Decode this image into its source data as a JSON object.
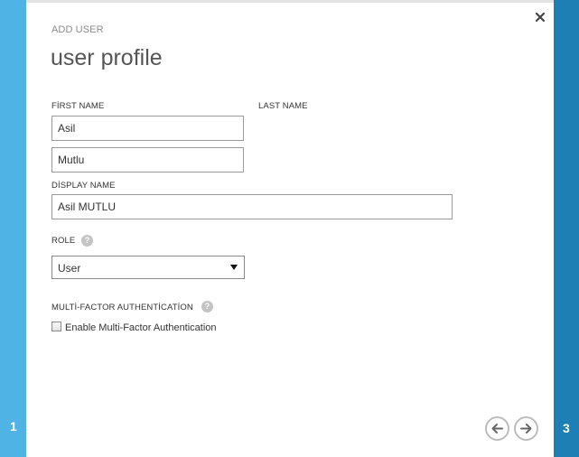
{
  "wizard": {
    "header": "ADD USER",
    "title": "user profile",
    "current_step": "1",
    "next_step": "3"
  },
  "form": {
    "first_name_label": "FİRST NAME",
    "first_name_value": "Asil",
    "last_name_label": "LAST NAME",
    "last_name_value": "Mutlu",
    "display_name_label": "DİSPLAY NAME",
    "display_name_value": "Asil MUTLU",
    "role_label": "ROLE",
    "role_value": "User",
    "mfa_label": "MULTİ-FACTOR AUTHENTİCATİON",
    "mfa_checkbox_label": "Enable Multi-Factor Authentication",
    "mfa_enabled": false
  },
  "icons": {
    "help": "question-mark-icon",
    "close": "close-icon",
    "back": "arrow-left-icon",
    "next": "arrow-right-icon",
    "dropdown": "caret-down-icon"
  },
  "colors": {
    "left_rail": "#4fb3e6",
    "right_rail": "#1e7fb5",
    "title_text": "#555555",
    "nav_button_border": "#bcbcbc"
  }
}
